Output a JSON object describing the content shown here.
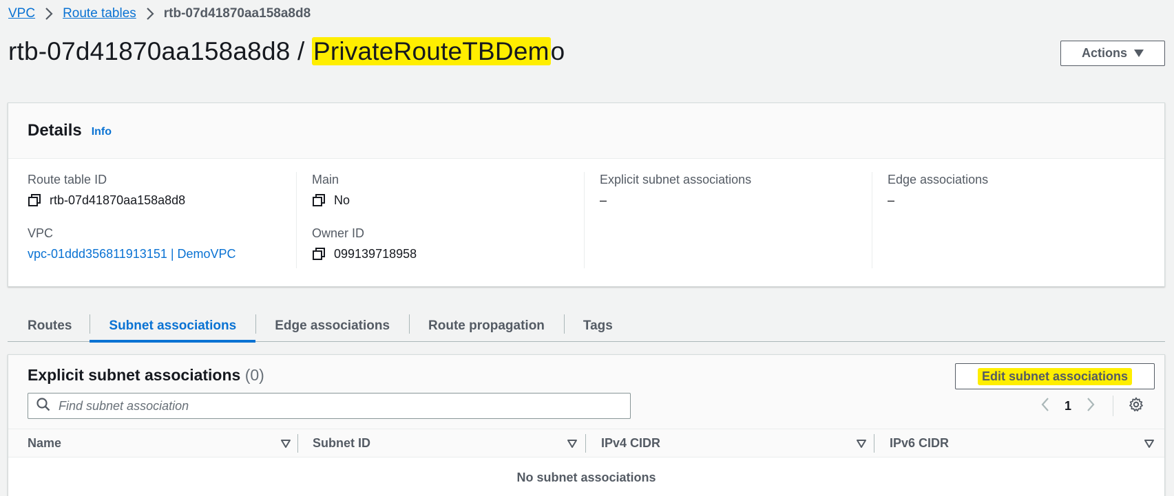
{
  "breadcrumb": {
    "items": [
      "VPC",
      "Route tables"
    ],
    "current": "rtb-07d41870aa158a8d8"
  },
  "header": {
    "title_id": "rtb-07d41870aa158a8d8 / ",
    "title_name_highlighted": "PrivateRouteTBDem",
    "title_name_rest": "o",
    "actions_label": "Actions"
  },
  "details": {
    "heading": "Details",
    "info": "Info",
    "route_table_id_label": "Route table ID",
    "route_table_id": "rtb-07d41870aa158a8d8",
    "vpc_label": "VPC",
    "vpc_value": "vpc-01ddd356811913151 | DemoVPC",
    "main_label": "Main",
    "main_value": "No",
    "owner_label": "Owner ID",
    "owner_value": "099139718958",
    "explicit_label": "Explicit subnet associations",
    "explicit_value": "–",
    "edge_label": "Edge associations",
    "edge_value": "–"
  },
  "tabs": [
    "Routes",
    "Subnet associations",
    "Edge associations",
    "Route propagation",
    "Tags"
  ],
  "active_tab": "Subnet associations",
  "associations": {
    "title": "Explicit subnet associations",
    "count": "(0)",
    "edit_label": "Edit subnet associations",
    "search_placeholder": "Find subnet association",
    "page": "1",
    "columns": [
      "Name",
      "Subnet ID",
      "IPv4 CIDR",
      "IPv6 CIDR"
    ],
    "empty_message": "No subnet associations"
  },
  "colors": {
    "link": "#0972d3",
    "highlight": "#ffee00",
    "background": "#f2f3f3",
    "text_secondary": "#545b64"
  },
  "icons": [
    "chevron-right-icon",
    "caret-down-icon",
    "copy-icon",
    "search-icon",
    "chevron-left-icon",
    "gear-icon",
    "sort-icon"
  ]
}
